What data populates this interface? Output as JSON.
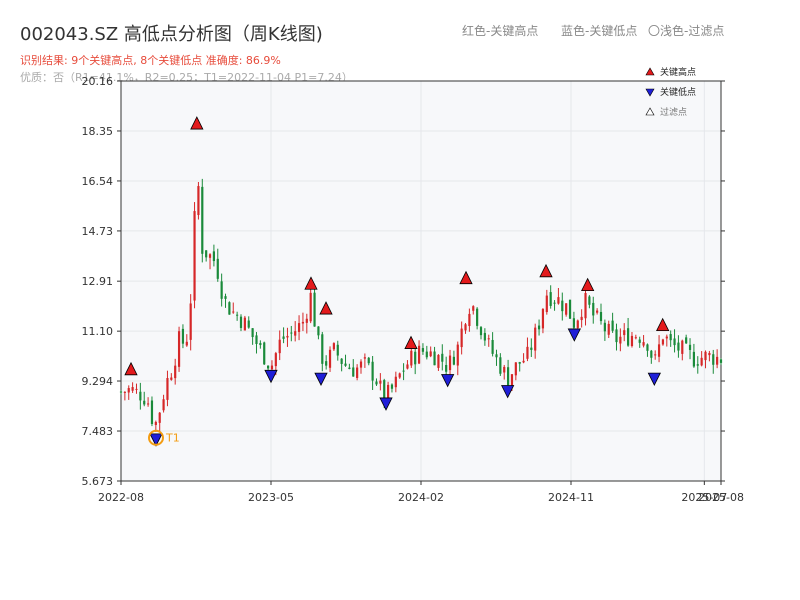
{
  "title": "002043.SZ 高低点分析图（周K线图)",
  "legend_top": {
    "red": "红色-关键高点",
    "blue": "蓝色-关键低点",
    "light": "〇浅色-过滤点"
  },
  "summary_line": "识别结果: 9个关键高点, 8个关键低点  准确度: 86.9%",
  "quality_line": "优质：否（R1=41.1%，R2=0.25；T1=2022-11-04 P1=7.24）",
  "colors": {
    "up": "#d62728",
    "down": "#1a8a3a",
    "high_marker": "#e31a1c",
    "low_marker": "#1f1fd8",
    "t1": "#f39c12",
    "grid": "#e5e7eb",
    "plot_bg": "#f7f8fa"
  },
  "chart_data": {
    "type": "candlestick",
    "title": "002043.SZ 高低点分析图（周K线图)",
    "x_range": [
      "2022-08",
      "2025-08"
    ],
    "ylim": [
      5.673,
      20.16
    ],
    "y_ticks": [
      "20.16",
      "18.35",
      "16.54",
      "14.73",
      "12.91",
      "11.10",
      "9.294",
      "7.483",
      "5.673"
    ],
    "x_ticks": [
      {
        "label": "2022-08",
        "t": 0
      },
      {
        "label": "2023-05",
        "t": 9
      },
      {
        "label": "2024-02",
        "t": 18
      },
      {
        "label": "2024-11",
        "t": 27
      },
      {
        "label": "2025-07",
        "t": 35
      },
      {
        "label": "2025-08",
        "t": 36
      }
    ],
    "close_path": [
      [
        0.0,
        8.9
      ],
      [
        0.6,
        9.0
      ],
      [
        1.2,
        8.8
      ],
      [
        1.6,
        8.6
      ],
      [
        2.0,
        7.6
      ],
      [
        2.4,
        8.4
      ],
      [
        2.7,
        9.2
      ],
      [
        3.1,
        9.8
      ],
      [
        3.5,
        10.8
      ],
      [
        3.9,
        10.6
      ],
      [
        4.3,
        13.0
      ],
      [
        4.55,
        17.6
      ],
      [
        4.8,
        14.2
      ],
      [
        5.2,
        13.9
      ],
      [
        5.7,
        13.6
      ],
      [
        6.2,
        12.2
      ],
      [
        6.7,
        11.8
      ],
      [
        7.3,
        11.5
      ],
      [
        7.9,
        10.9
      ],
      [
        8.4,
        10.4
      ],
      [
        9.0,
        9.8
      ],
      [
        9.6,
        10.8
      ],
      [
        10.2,
        11.0
      ],
      [
        10.9,
        11.4
      ],
      [
        11.4,
        12.4
      ],
      [
        11.8,
        10.7
      ],
      [
        12.2,
        9.9
      ],
      [
        12.8,
        10.4
      ],
      [
        13.4,
        9.9
      ],
      [
        14.0,
        9.7
      ],
      [
        14.6,
        9.9
      ],
      [
        15.2,
        9.5
      ],
      [
        15.8,
        8.7
      ],
      [
        16.3,
        9.0
      ],
      [
        16.9,
        9.7
      ],
      [
        17.4,
        10.1
      ],
      [
        18.0,
        10.4
      ],
      [
        18.6,
        10.3
      ],
      [
        19.2,
        10.1
      ],
      [
        19.6,
        9.8
      ],
      [
        20.2,
        10.5
      ],
      [
        20.7,
        11.8
      ],
      [
        21.0,
        12.2
      ],
      [
        21.5,
        11.4
      ],
      [
        22.1,
        10.5
      ],
      [
        22.8,
        9.8
      ],
      [
        23.2,
        9.4
      ],
      [
        23.8,
        9.9
      ],
      [
        24.4,
        10.2
      ],
      [
        25.0,
        11.2
      ],
      [
        25.5,
        12.5
      ],
      [
        26.1,
        12.3
      ],
      [
        26.7,
        12.0
      ],
      [
        27.2,
        11.4
      ],
      [
        27.8,
        12.2
      ],
      [
        28.4,
        11.6
      ],
      [
        29.0,
        11.2
      ],
      [
        29.6,
        10.8
      ],
      [
        30.3,
        10.9
      ],
      [
        31.0,
        11.0
      ],
      [
        31.6,
        10.7
      ],
      [
        32.0,
        9.9
      ],
      [
        32.5,
        11.0
      ],
      [
        33.0,
        10.6
      ],
      [
        33.7,
        10.4
      ],
      [
        34.4,
        10.1
      ],
      [
        35.2,
        10.2
      ],
      [
        36.0,
        10.1
      ]
    ],
    "key_highs": [
      {
        "t": 0.6,
        "price": 9.7
      },
      {
        "t": 4.55,
        "price": 18.6
      },
      {
        "t": 11.4,
        "price": 12.8
      },
      {
        "t": 12.3,
        "price": 11.9
      },
      {
        "t": 17.4,
        "price": 10.65
      },
      {
        "t": 20.7,
        "price": 13.0
      },
      {
        "t": 25.5,
        "price": 13.25
      },
      {
        "t": 28.0,
        "price": 12.75
      },
      {
        "t": 32.5,
        "price": 11.3
      }
    ],
    "key_lows": [
      {
        "t": 2.1,
        "price": 7.2
      },
      {
        "t": 9.0,
        "price": 9.5
      },
      {
        "t": 12.0,
        "price": 9.4
      },
      {
        "t": 15.9,
        "price": 8.5
      },
      {
        "t": 19.6,
        "price": 9.35
      },
      {
        "t": 23.2,
        "price": 8.95
      },
      {
        "t": 27.2,
        "price": 11.0
      },
      {
        "t": 32.0,
        "price": 9.4
      }
    ],
    "t1_marker": {
      "t": 2.1,
      "price": 7.24,
      "label": "T1"
    },
    "legend": [
      {
        "label": "关键高点",
        "type": "high"
      },
      {
        "label": "关键低点",
        "type": "low"
      },
      {
        "label": "过滤点",
        "type": "filtered"
      }
    ],
    "grid": true,
    "legend_position": "top-right"
  }
}
